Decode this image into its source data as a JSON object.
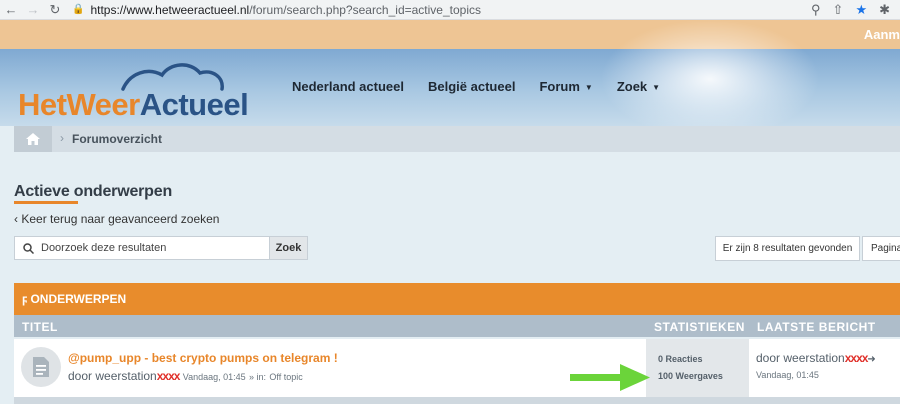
{
  "browser": {
    "url_host": "https://www.hetweeractueel.nl",
    "url_path": "/forum/search.php?search_id=active_topics",
    "icons": [
      "back-arrow-icon",
      "forward-arrow-icon",
      "reload-icon",
      "lock-icon",
      "zoom-icon",
      "share-icon",
      "star-icon",
      "extensions-icon"
    ]
  },
  "top_strip": {
    "login": "Aanm"
  },
  "logo": {
    "part1": "HetWeer",
    "part2": "Actueel",
    "colors": {
      "orange": "#e8862a",
      "blue": "#2a5386"
    }
  },
  "nav": {
    "items": [
      {
        "label": "Nederland actueel"
      },
      {
        "label": "België actueel"
      },
      {
        "label": "Forum"
      },
      {
        "label": "Zoek"
      }
    ]
  },
  "breadcrumb": {
    "item": "Forumoverzicht"
  },
  "page": {
    "title": "Actieve onderwerpen",
    "back_link": "Keer terug naar geavanceerd zoeken"
  },
  "search": {
    "placeholder": "Doorzoek deze resultaten",
    "button": "Zoek"
  },
  "pagination": {
    "results": "Er zijn 8 resultaten gevonden",
    "page": "Pagina"
  },
  "topics": {
    "header": "ONDERWERPEN",
    "columns": {
      "title": "TITEL",
      "stats": "STATISTIEKEN",
      "last_post": "LAATSTE BERICHT"
    },
    "rows": [
      {
        "title": "@pump_upp - best crypto pumps on telegram !",
        "by": "door weerstation",
        "redacted": "xxxx",
        "time": "Vandaag, 01:45",
        "in_prefix": "» in:",
        "forum": "Off topic",
        "replies": "0 Reacties",
        "views": "100 Weergaves",
        "last_by": "door weerstation",
        "last_redacted": "xxxx",
        "last_time": "Vandaag, 01:45"
      }
    ]
  },
  "colors": {
    "accent": "#e88c2c",
    "arrow": "#6bd43a",
    "header_bg": "#aebdca"
  }
}
